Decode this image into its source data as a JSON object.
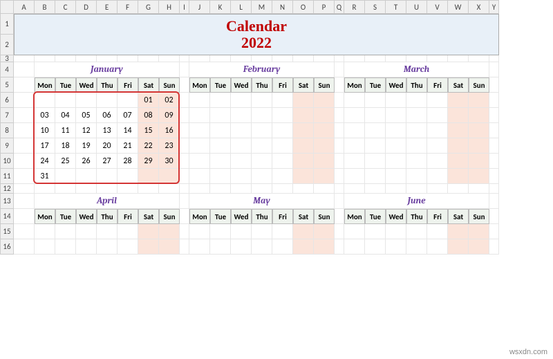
{
  "columns": [
    "A",
    "B",
    "C",
    "D",
    "E",
    "F",
    "G",
    "H",
    "I",
    "J",
    "K",
    "L",
    "M",
    "N",
    "O",
    "P",
    "Q",
    "R",
    "S",
    "T",
    "U",
    "V",
    "W",
    "X",
    "Y"
  ],
  "rows": [
    "1",
    "2",
    "3",
    "4",
    "5",
    "6",
    "7",
    "8",
    "9",
    "10",
    "11",
    "12",
    "13",
    "14",
    "15"
  ],
  "title": {
    "line1": "Calendar",
    "line2": "2022"
  },
  "weekdays": [
    "Mon",
    "Tue",
    "Wed",
    "Thu",
    "Fri",
    "Sat",
    "Sun"
  ],
  "months_row1": [
    "January",
    "February",
    "March"
  ],
  "months_row2": [
    "April",
    "May",
    "June"
  ],
  "january": [
    [
      "",
      "",
      "",
      "",
      "",
      "01",
      "02"
    ],
    [
      "03",
      "04",
      "05",
      "06",
      "07",
      "08",
      "09"
    ],
    [
      "10",
      "11",
      "12",
      "13",
      "14",
      "15",
      "16"
    ],
    [
      "17",
      "18",
      "19",
      "20",
      "21",
      "22",
      "23"
    ],
    [
      "24",
      "25",
      "26",
      "27",
      "28",
      "29",
      "30"
    ],
    [
      "31",
      "",
      "",
      "",
      "",
      "",
      ""
    ]
  ],
  "watermark": "wsxdn.com"
}
